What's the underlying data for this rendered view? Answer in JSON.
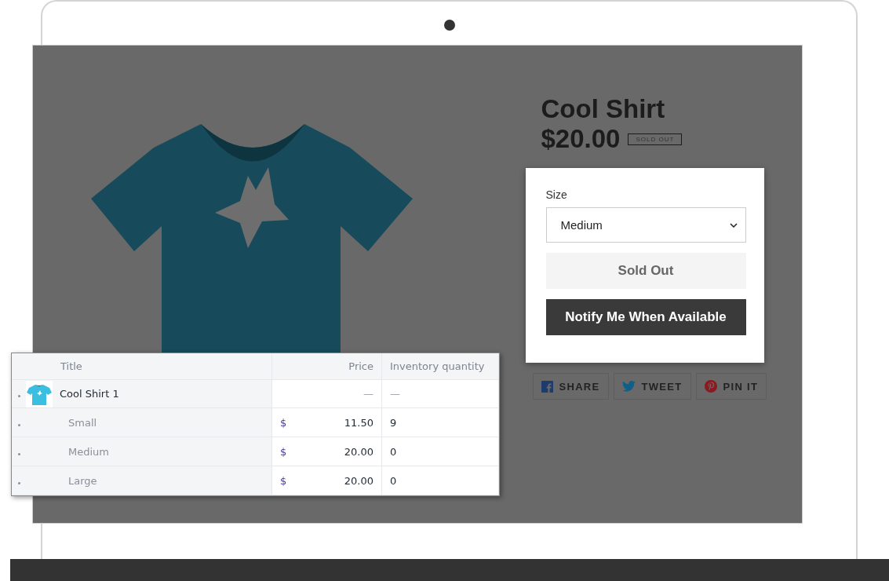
{
  "product": {
    "title": "Cool Shirt",
    "price": "$20.00",
    "badge": "SOLD OUT",
    "size_label": "Size",
    "size_value": "Medium",
    "sold_out_button": "Sold Out",
    "notify_button": "Notify Me When Available",
    "share_buttons": [
      {
        "kind": "facebook",
        "label": "SHARE"
      },
      {
        "kind": "twitter",
        "label": "TWEET"
      },
      {
        "kind": "pinterest",
        "label": "PIN IT"
      }
    ]
  },
  "table": {
    "columns": [
      "Title",
      "Price",
      "Inventory quantity"
    ],
    "rows": [
      {
        "kind": "product",
        "title": "Cool Shirt 1",
        "price": "—",
        "quantity": "—"
      },
      {
        "kind": "variant",
        "title": "Small",
        "currency": "$",
        "price": "11.50",
        "quantity": "9"
      },
      {
        "kind": "variant",
        "title": "Medium",
        "currency": "$",
        "price": "20.00",
        "quantity": "0"
      },
      {
        "kind": "variant",
        "title": "Large",
        "currency": "$",
        "price": "20.00",
        "quantity": "0"
      }
    ]
  }
}
